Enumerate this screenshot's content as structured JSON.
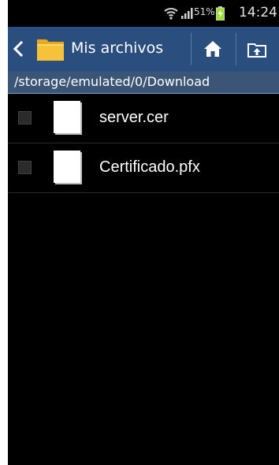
{
  "status_bar": {
    "battery_percent": "51%",
    "time": "14:24",
    "icons": [
      "wifi-icon",
      "signal-icon",
      "battery-charging-icon"
    ]
  },
  "action_bar": {
    "title": "Mis archivos",
    "icons": [
      "back-arrow-icon",
      "folder-icon",
      "home-icon",
      "up-folder-icon"
    ]
  },
  "path": "/storage/emulated/0/Download",
  "files": [
    {
      "name": "server.cer",
      "icon": "file-icon"
    },
    {
      "name": "Certificado.pfx",
      "icon": "file-icon"
    }
  ],
  "colors": {
    "action_bar_bg": "#2a4f7f",
    "path_bar_bg": "#3a5576",
    "list_bg": "#000000",
    "folder_yellow": "#f6c23a"
  }
}
